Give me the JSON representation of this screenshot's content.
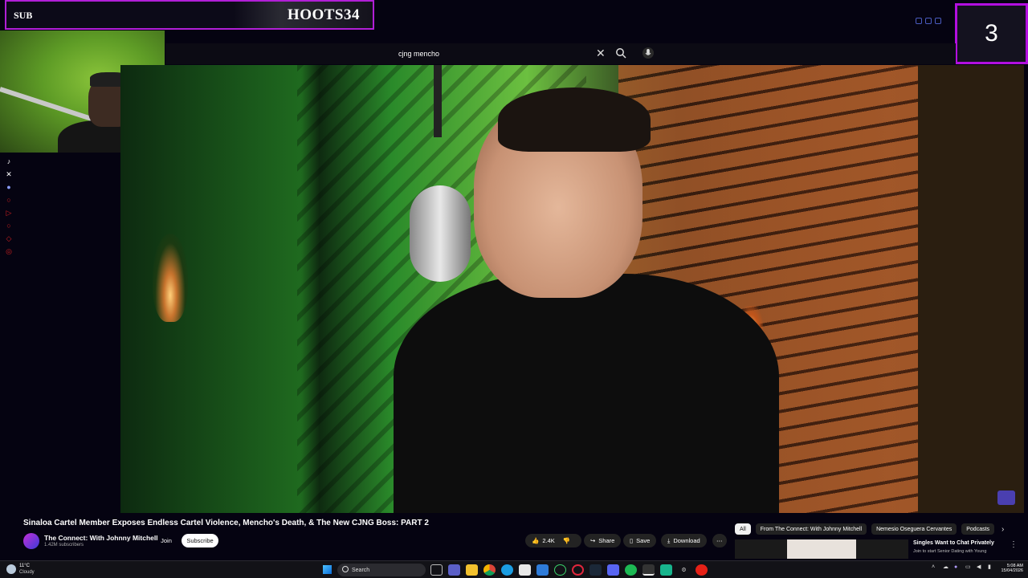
{
  "overlay": {
    "sub_label": "SUB",
    "streamer_name": "HOOTS34",
    "counter": "3"
  },
  "search": {
    "value": "cjng mencho"
  },
  "video": {
    "title": "Sinaloa Cartel Member Exposes Endless Cartel Violence, Mencho's Death, & The New CJNG Boss: PART 2",
    "channel_name": "The Connect: With Johnny Mitchell",
    "subscribers": "1.42M subscribers",
    "join_label": "Join",
    "subscribe_label": "Subscribe",
    "likes": "2.4K",
    "share_label": "Share",
    "save_label": "Save",
    "download_label": "Download"
  },
  "chips": [
    "All",
    "From The Connect: With Johnny Mitchell",
    "Nemesio Oseguera Cervantes",
    "Podcasts"
  ],
  "recommendation": {
    "title": "Singles Want to Chat Privately",
    "description": "Join to start Senior Dating with Young"
  },
  "taskbar": {
    "weather_temp": "11°C",
    "weather_condition": "Cloudy",
    "search_label": "Search",
    "time": "5:08 AM",
    "date": "15/04/2026"
  },
  "colors": {
    "accent_purple": "#b11fd6",
    "background": "#050311"
  }
}
